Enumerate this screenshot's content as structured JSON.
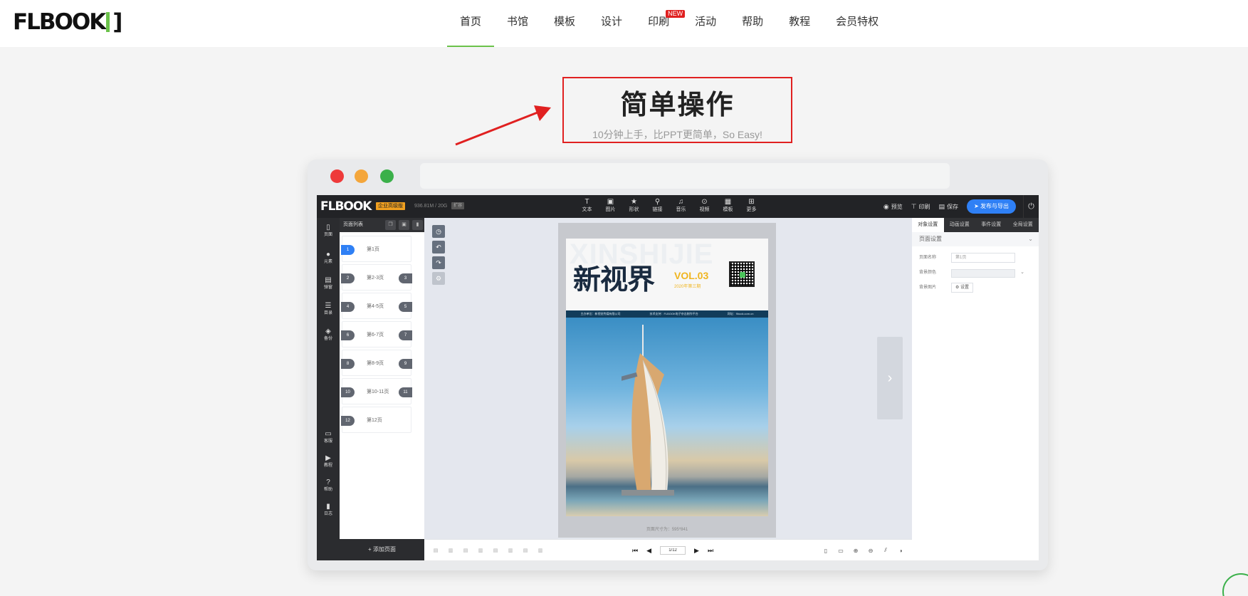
{
  "site": {
    "logo": "FLBOOK",
    "nav": [
      {
        "label": "首页",
        "active": true
      },
      {
        "label": "书馆"
      },
      {
        "label": "模板"
      },
      {
        "label": "设计"
      },
      {
        "label": "印刷",
        "badge": "NEW"
      },
      {
        "label": "活动"
      },
      {
        "label": "帮助"
      },
      {
        "label": "教程"
      },
      {
        "label": "会员特权"
      }
    ]
  },
  "hero": {
    "title": "简单操作",
    "subtitle": "10分钟上手，比PPT更简单，So Easy!"
  },
  "editor": {
    "logo": "FLBOOK",
    "vip_badge": "企业高级版",
    "storage": "936.81M / 20G",
    "storage_btn": "扩容",
    "tools": [
      {
        "icon": "T",
        "label": "文本"
      },
      {
        "icon": "▣",
        "label": "图片"
      },
      {
        "icon": "★",
        "label": "形状"
      },
      {
        "icon": "⚲",
        "label": "链接"
      },
      {
        "icon": "♫",
        "label": "音乐"
      },
      {
        "icon": "⊙",
        "label": "视频"
      },
      {
        "icon": "▦",
        "label": "模板"
      },
      {
        "icon": "⊞",
        "label": "更多"
      }
    ],
    "right_actions": {
      "preview": "预览",
      "print": "印刷",
      "save": "保存",
      "publish": "发布与导出"
    },
    "sidebar": [
      {
        "icon": "▯",
        "label": "页面"
      },
      {
        "icon": "●",
        "label": "元素"
      },
      {
        "icon": "▤",
        "label": "弹窗"
      },
      {
        "icon": "☰",
        "label": "目录"
      },
      {
        "icon": "◈",
        "label": "备份"
      },
      {
        "icon": "▭",
        "label": "客服"
      },
      {
        "icon": "▶",
        "label": "教程"
      },
      {
        "icon": "?",
        "label": "帮助"
      },
      {
        "icon": "▮",
        "label": "日志"
      }
    ],
    "page_list": {
      "title": "页面列表",
      "items": [
        {
          "left": "1",
          "name": "第1页",
          "right": ""
        },
        {
          "left": "2",
          "name": "第2-3页",
          "right": "3"
        },
        {
          "left": "4",
          "name": "第4-5页",
          "right": "5"
        },
        {
          "left": "6",
          "name": "第6-7页",
          "right": "7"
        },
        {
          "left": "8",
          "name": "第8-9页",
          "right": "9"
        },
        {
          "left": "10",
          "name": "第10-11页",
          "right": "11"
        },
        {
          "left": "12",
          "name": "第12页",
          "right": ""
        }
      ],
      "add_page": "+ 添加页面"
    },
    "magazine": {
      "bg_word": "XINSHIJIE",
      "title": "新视界",
      "vol": "VOL.03",
      "issue": "2020年第三期",
      "bar_items": [
        "主办单位：新视觉传媒有限公司",
        "技术支持：FLBOOK电子杂志制作平台",
        "网址：flbook.com.cn"
      ]
    },
    "canvas_caption": "页面尺寸为：595*841",
    "pager": {
      "value": "1/12"
    },
    "props": {
      "tabs": [
        "对象设置",
        "动画设置",
        "事件设置",
        "全局设置"
      ],
      "section": "页面设置",
      "rows": {
        "name_label": "页面名称",
        "name_value": "第1页",
        "bgcolor_label": "背景颜色",
        "bgimage_label": "背景图片",
        "bgimage_btn": "⚙ 设置"
      }
    }
  }
}
